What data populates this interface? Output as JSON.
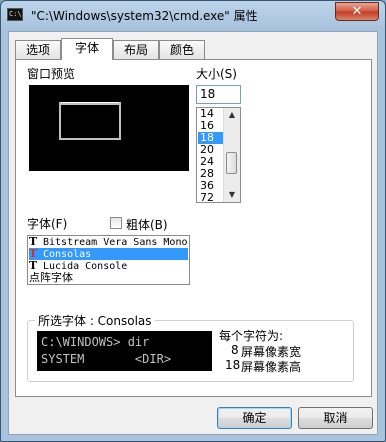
{
  "window": {
    "title": "\"C:\\Windows\\system32\\cmd.exe\" 属性",
    "icon_text": "C:\\",
    "close_label": "✕"
  },
  "tabs": [
    "选项",
    "字体",
    "布局",
    "颜色"
  ],
  "active_tab": "字体",
  "preview": {
    "label": "窗口预览"
  },
  "size": {
    "label": "大小(S)",
    "value": "18",
    "items": [
      "14",
      "16",
      "18",
      "20",
      "24",
      "28",
      "36",
      "72"
    ],
    "selected": "18"
  },
  "font": {
    "label": "字体(F)",
    "bold_label": "粗体(B)",
    "bold_checked": false,
    "items": [
      {
        "name": "Bitstream Vera Sans Mono",
        "truetype": true
      },
      {
        "name": "Consolas",
        "truetype": true
      },
      {
        "name": "Lucida Console",
        "truetype": true
      },
      {
        "name": "点阵字体",
        "truetype": false
      }
    ],
    "selected": "Consolas"
  },
  "selected_font": {
    "label": "所选字体 : Consolas",
    "sample_lines": [
      "C:\\WINDOWS> dir",
      "SYSTEM       <DIR>"
    ],
    "per_char_label": "每个字符为:",
    "width_value": "8",
    "width_label": "屏幕像素宽",
    "height_value": "18",
    "height_label": "屏幕像素高"
  },
  "buttons": {
    "ok": "确定",
    "cancel": "取消"
  },
  "colors": {
    "selection": "#3399ff",
    "close": "#c7432a"
  }
}
